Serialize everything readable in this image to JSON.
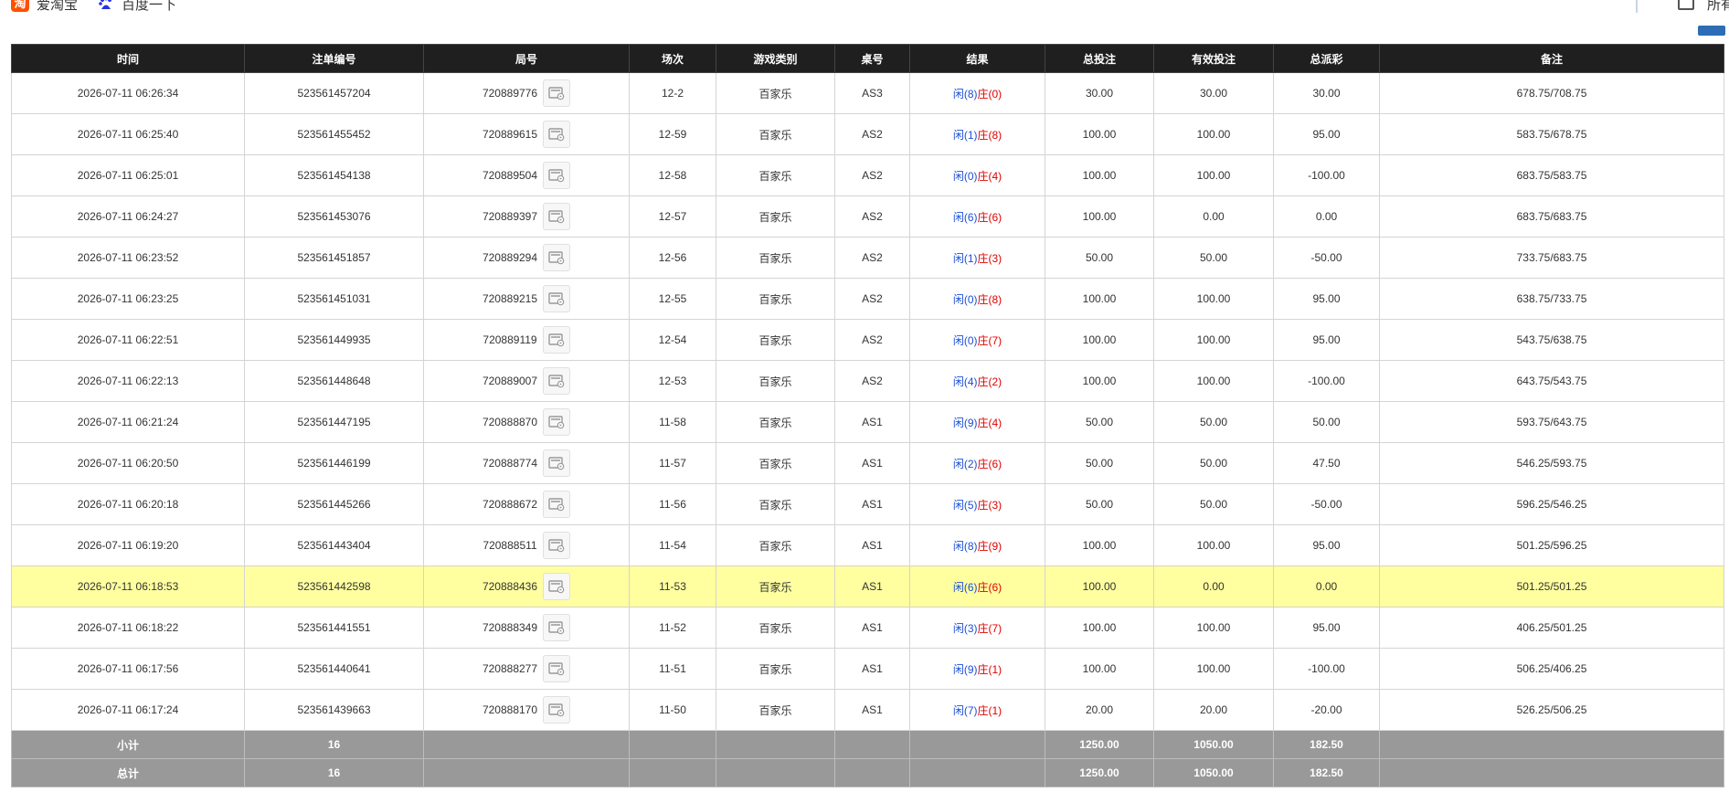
{
  "bookmarks": [
    {
      "icon": "taobao-icon",
      "label": "爱淘宝"
    },
    {
      "icon": "baidu-icon",
      "label": "百度一下"
    }
  ],
  "bookmarks_all": "所有书签",
  "table": {
    "headers": [
      "时间",
      "注单编号",
      "局号",
      "场次",
      "游戏类别",
      "桌号",
      "结果",
      "总投注",
      "有效投注",
      "总派彩",
      "备注"
    ],
    "rows": [
      {
        "time": "2026-07-11 06:26:34",
        "bet_id": "523561457204",
        "round": "720889776",
        "shoe": "12-2",
        "game": "百家乐",
        "table": "AS3",
        "player": "闲(8)",
        "banker": "庄(0)",
        "total": "30.00",
        "valid": "30.00",
        "payout": "30.00",
        "payout_neg": false,
        "note": "678.75/708.75"
      },
      {
        "time": "2026-07-11 06:25:40",
        "bet_id": "523561455452",
        "round": "720889615",
        "shoe": "12-59",
        "game": "百家乐",
        "table": "AS2",
        "player": "闲(1)",
        "banker": "庄(8)",
        "total": "100.00",
        "valid": "100.00",
        "payout": "95.00",
        "payout_neg": false,
        "note": "583.75/678.75"
      },
      {
        "time": "2026-07-11 06:25:01",
        "bet_id": "523561454138",
        "round": "720889504",
        "shoe": "12-58",
        "game": "百家乐",
        "table": "AS2",
        "player": "闲(0)",
        "banker": "庄(4)",
        "total": "100.00",
        "valid": "100.00",
        "payout": "-100.00",
        "payout_neg": true,
        "note": "683.75/583.75"
      },
      {
        "time": "2026-07-11 06:24:27",
        "bet_id": "523561453076",
        "round": "720889397",
        "shoe": "12-57",
        "game": "百家乐",
        "table": "AS2",
        "player": "闲(6)",
        "banker": "庄(6)",
        "total": "100.00",
        "valid": "0.00",
        "payout": "0.00",
        "payout_neg": false,
        "note": "683.75/683.75"
      },
      {
        "time": "2026-07-11 06:23:52",
        "bet_id": "523561451857",
        "round": "720889294",
        "shoe": "12-56",
        "game": "百家乐",
        "table": "AS2",
        "player": "闲(1)",
        "banker": "庄(3)",
        "total": "50.00",
        "valid": "50.00",
        "payout": "-50.00",
        "payout_neg": true,
        "note": "733.75/683.75"
      },
      {
        "time": "2026-07-11 06:23:25",
        "bet_id": "523561451031",
        "round": "720889215",
        "shoe": "12-55",
        "game": "百家乐",
        "table": "AS2",
        "player": "闲(0)",
        "banker": "庄(8)",
        "total": "100.00",
        "valid": "100.00",
        "payout": "95.00",
        "payout_neg": false,
        "note": "638.75/733.75"
      },
      {
        "time": "2026-07-11 06:22:51",
        "bet_id": "523561449935",
        "round": "720889119",
        "shoe": "12-54",
        "game": "百家乐",
        "table": "AS2",
        "player": "闲(0)",
        "banker": "庄(7)",
        "total": "100.00",
        "valid": "100.00",
        "payout": "95.00",
        "payout_neg": false,
        "note": "543.75/638.75"
      },
      {
        "time": "2026-07-11 06:22:13",
        "bet_id": "523561448648",
        "round": "720889007",
        "shoe": "12-53",
        "game": "百家乐",
        "table": "AS2",
        "player": "闲(4)",
        "banker": "庄(2)",
        "total": "100.00",
        "valid": "100.00",
        "payout": "-100.00",
        "payout_neg": true,
        "note": "643.75/543.75"
      },
      {
        "time": "2026-07-11 06:21:24",
        "bet_id": "523561447195",
        "round": "720888870",
        "shoe": "11-58",
        "game": "百家乐",
        "table": "AS1",
        "player": "闲(9)",
        "banker": "庄(4)",
        "total": "50.00",
        "valid": "50.00",
        "payout": "50.00",
        "payout_neg": false,
        "note": "593.75/643.75"
      },
      {
        "time": "2026-07-11 06:20:50",
        "bet_id": "523561446199",
        "round": "720888774",
        "shoe": "11-57",
        "game": "百家乐",
        "table": "AS1",
        "player": "闲(2)",
        "banker": "庄(6)",
        "total": "50.00",
        "valid": "50.00",
        "payout": "47.50",
        "payout_neg": false,
        "note": "546.25/593.75"
      },
      {
        "time": "2026-07-11 06:20:18",
        "bet_id": "523561445266",
        "round": "720888672",
        "shoe": "11-56",
        "game": "百家乐",
        "table": "AS1",
        "player": "闲(5)",
        "banker": "庄(3)",
        "total": "50.00",
        "valid": "50.00",
        "payout": "-50.00",
        "payout_neg": true,
        "note": "596.25/546.25"
      },
      {
        "time": "2026-07-11 06:19:20",
        "bet_id": "523561443404",
        "round": "720888511",
        "shoe": "11-54",
        "game": "百家乐",
        "table": "AS1",
        "player": "闲(8)",
        "banker": "庄(9)",
        "total": "100.00",
        "valid": "100.00",
        "payout": "95.00",
        "payout_neg": false,
        "note": "501.25/596.25"
      },
      {
        "time": "2026-07-11 06:18:53",
        "bet_id": "523561442598",
        "round": "720888436",
        "shoe": "11-53",
        "game": "百家乐",
        "table": "AS1",
        "player": "闲(6)",
        "banker": "庄(6)",
        "total": "100.00",
        "valid": "0.00",
        "payout": "0.00",
        "payout_neg": false,
        "note": "501.25/501.25",
        "highlight": true
      },
      {
        "time": "2026-07-11 06:18:22",
        "bet_id": "523561441551",
        "round": "720888349",
        "shoe": "11-52",
        "game": "百家乐",
        "table": "AS1",
        "player": "闲(3)",
        "banker": "庄(7)",
        "total": "100.00",
        "valid": "100.00",
        "payout": "95.00",
        "payout_neg": false,
        "note": "406.25/501.25"
      },
      {
        "time": "2026-07-11 06:17:56",
        "bet_id": "523561440641",
        "round": "720888277",
        "shoe": "11-51",
        "game": "百家乐",
        "table": "AS1",
        "player": "闲(9)",
        "banker": "庄(1)",
        "total": "100.00",
        "valid": "100.00",
        "payout": "-100.00",
        "payout_neg": true,
        "note": "506.25/406.25"
      },
      {
        "time": "2026-07-11 06:17:24",
        "bet_id": "523561439663",
        "round": "720888170",
        "shoe": "11-50",
        "game": "百家乐",
        "table": "AS1",
        "player": "闲(7)",
        "banker": "庄(1)",
        "total": "20.00",
        "valid": "20.00",
        "payout": "-20.00",
        "payout_neg": true,
        "note": "526.25/506.25"
      }
    ],
    "summary": [
      {
        "label": "小计",
        "count": "16",
        "total": "1250.00",
        "valid": "1050.00",
        "payout": "182.50"
      },
      {
        "label": "总计",
        "count": "16",
        "total": "1250.00",
        "valid": "1050.00",
        "payout": "182.50"
      }
    ]
  },
  "colors": {
    "header_bg": "#1f1f1f",
    "summary_bg": "#999999",
    "highlight_row": "#ffff9f",
    "player": "#1a4fd6",
    "banker": "#e00000",
    "negative": "#e00000"
  }
}
